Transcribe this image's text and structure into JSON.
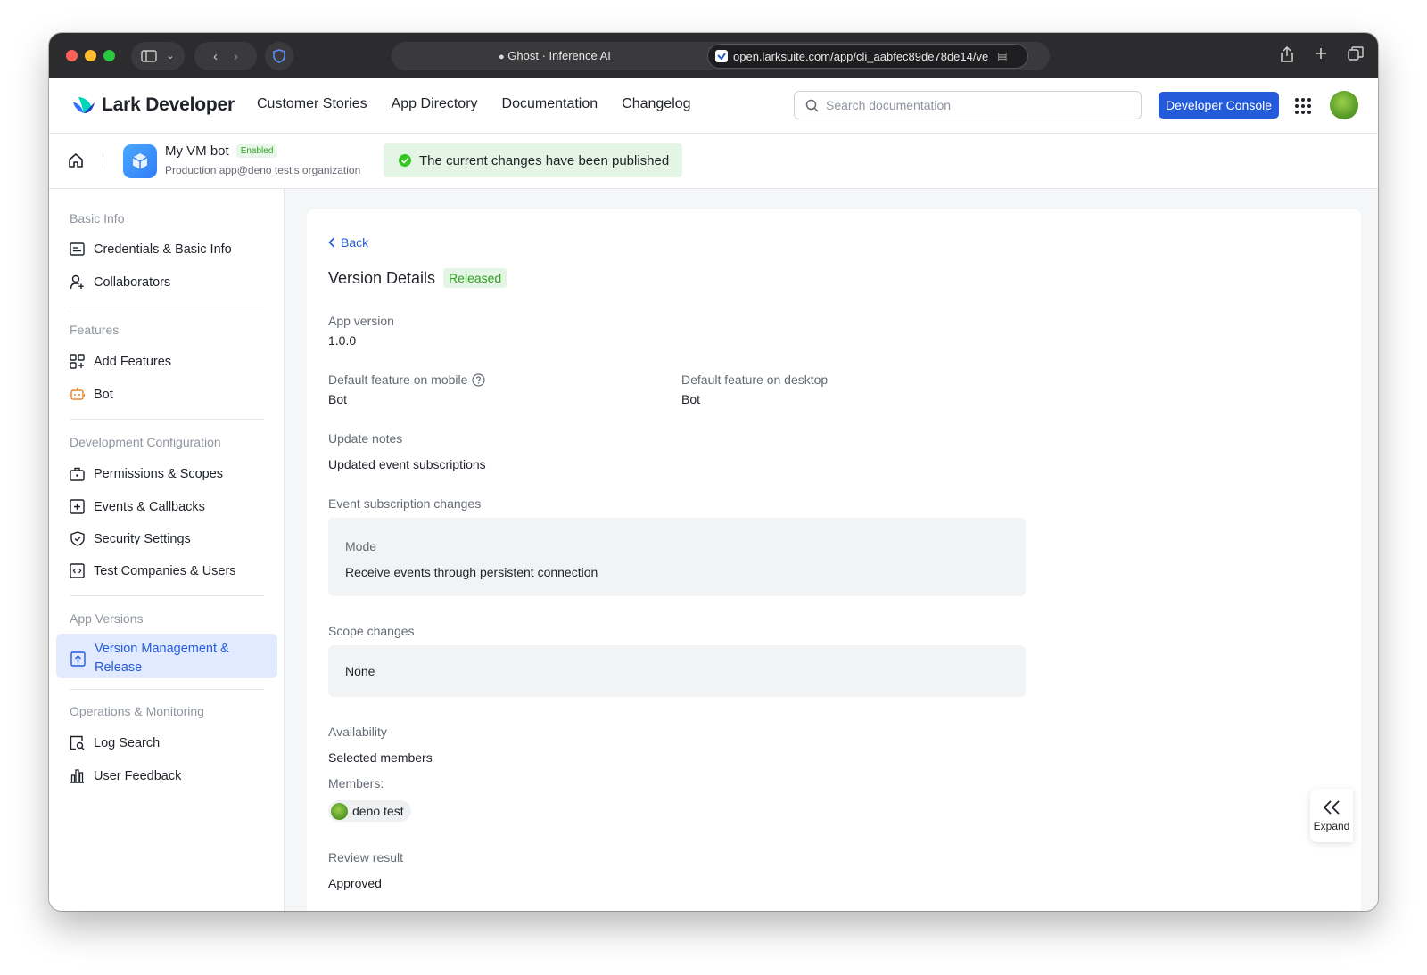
{
  "browser": {
    "tab_title": "Ghost · Inference AI",
    "url": "open.larksuite.com/app/cli_aabfec89de78de14/ve"
  },
  "header": {
    "logo_text": "Lark Developer",
    "nav": [
      "Customer Stories",
      "App Directory",
      "Documentation",
      "Changelog"
    ],
    "search_placeholder": "Search documentation",
    "console_button": "Developer Console"
  },
  "app": {
    "name": "My VM bot",
    "status": "Enabled",
    "subtitle": "Production app@deno test's organization",
    "toast": "The current changes have been published"
  },
  "sidebar": {
    "groups": [
      {
        "label": "Basic Info",
        "items": [
          {
            "label": "Credentials & Basic Info",
            "icon": "id-card-icon"
          },
          {
            "label": "Collaborators",
            "icon": "user-add-icon"
          }
        ]
      },
      {
        "label": "Features",
        "items": [
          {
            "label": "Add Features",
            "icon": "apps-add-icon"
          },
          {
            "label": "Bot",
            "icon": "robot-icon"
          }
        ]
      },
      {
        "label": "Development Configuration",
        "items": [
          {
            "label": "Permissions & Scopes",
            "icon": "briefcase-icon"
          },
          {
            "label": "Events & Callbacks",
            "icon": "event-add-icon"
          },
          {
            "label": "Security Settings",
            "icon": "shield-icon"
          },
          {
            "label": "Test Companies & Users",
            "icon": "code-box-icon"
          }
        ]
      },
      {
        "label": "App Versions",
        "items": [
          {
            "label": "Version Management & Release",
            "icon": "upload-box-icon",
            "active": true
          }
        ]
      },
      {
        "label": "Operations & Monitoring",
        "items": [
          {
            "label": "Log Search",
            "icon": "log-search-icon"
          },
          {
            "label": "User Feedback",
            "icon": "bar-chart-icon"
          }
        ]
      }
    ]
  },
  "details": {
    "back": "Back",
    "title": "Version Details",
    "status": "Released",
    "app_version_label": "App version",
    "app_version": "1.0.0",
    "mobile_label": "Default feature on mobile",
    "mobile_value": "Bot",
    "desktop_label": "Default feature on desktop",
    "desktop_value": "Bot",
    "notes_label": "Update notes",
    "notes_value": "Updated event subscriptions",
    "event_changes_label": "Event subscription changes",
    "mode_label": "Mode",
    "mode_value": "Receive events through persistent connection",
    "scope_changes_label": "Scope changes",
    "scope_changes_value": "None",
    "availability_label": "Availability",
    "availability_value": "Selected members",
    "members_label": "Members:",
    "member_name": "deno test",
    "review_label": "Review result",
    "review_value": "Approved"
  },
  "expand_label": "Expand",
  "colors": {
    "accent": "#245bdb",
    "success_bg": "#e4f5e5",
    "success_text": "#2ea121",
    "active_bg": "#e1eaff"
  }
}
